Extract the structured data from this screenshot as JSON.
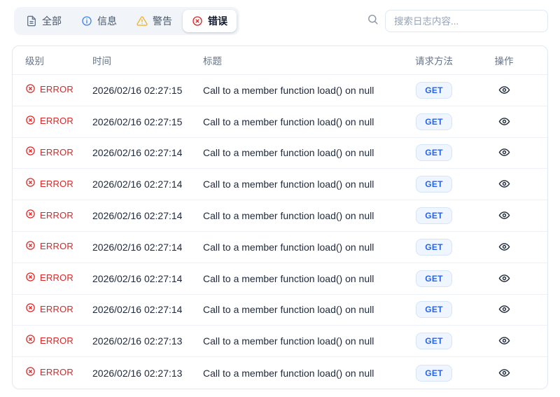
{
  "toolbar": {
    "tabs": [
      {
        "label": "全部",
        "icon": "document-icon",
        "active": false
      },
      {
        "label": "信息",
        "icon": "info-icon",
        "active": false
      },
      {
        "label": "警告",
        "icon": "warning-icon",
        "active": false
      },
      {
        "label": "错误",
        "icon": "error-icon",
        "active": true
      }
    ],
    "search": {
      "placeholder": "搜索日志内容..."
    }
  },
  "table": {
    "headers": [
      "级别",
      "时间",
      "标题",
      "请求方法",
      "操作"
    ],
    "rows": [
      {
        "level": "ERROR",
        "time": "2026/02/16 02:27:15",
        "title": "Call to a member function load() on null",
        "method": "GET"
      },
      {
        "level": "ERROR",
        "time": "2026/02/16 02:27:15",
        "title": "Call to a member function load() on null",
        "method": "GET"
      },
      {
        "level": "ERROR",
        "time": "2026/02/16 02:27:14",
        "title": "Call to a member function load() on null",
        "method": "GET"
      },
      {
        "level": "ERROR",
        "time": "2026/02/16 02:27:14",
        "title": "Call to a member function load() on null",
        "method": "GET"
      },
      {
        "level": "ERROR",
        "time": "2026/02/16 02:27:14",
        "title": "Call to a member function load() on null",
        "method": "GET"
      },
      {
        "level": "ERROR",
        "time": "2026/02/16 02:27:14",
        "title": "Call to a member function load() on null",
        "method": "GET"
      },
      {
        "level": "ERROR",
        "time": "2026/02/16 02:27:14",
        "title": "Call to a member function load() on null",
        "method": "GET"
      },
      {
        "level": "ERROR",
        "time": "2026/02/16 02:27:14",
        "title": "Call to a member function load() on null",
        "method": "GET"
      },
      {
        "level": "ERROR",
        "time": "2026/02/16 02:27:13",
        "title": "Call to a member function load() on null",
        "method": "GET"
      },
      {
        "level": "ERROR",
        "time": "2026/02/16 02:27:13",
        "title": "Call to a member function load() on null",
        "method": "GET"
      }
    ]
  },
  "colors": {
    "error": "#dc2626",
    "info": "#3b82f6",
    "warning": "#f0b429",
    "method_badge_text": "#2563eb",
    "method_badge_bg": "#eff6ff",
    "tab_group_bg": "#f1f5f9",
    "card_border": "#e2e8f0",
    "header_text": "#64748b"
  }
}
